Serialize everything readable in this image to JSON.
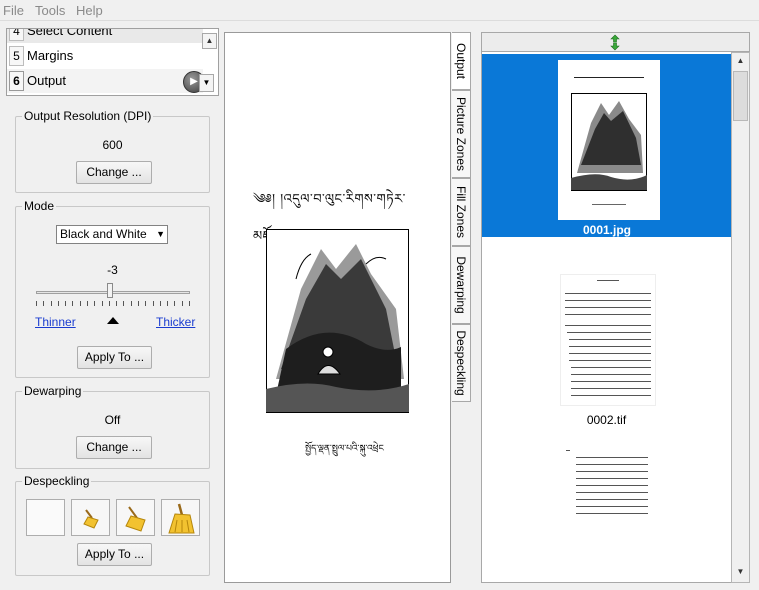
{
  "menu": {
    "items": [
      "File",
      "Tools",
      "Help"
    ]
  },
  "stages": {
    "top_partial": {
      "num": "4",
      "label": "Select Content"
    },
    "items": [
      {
        "num": "5",
        "label": "Margins"
      },
      {
        "num": "6",
        "label": "Output"
      }
    ]
  },
  "output_resolution": {
    "title": "Output Resolution (DPI)",
    "value": "600",
    "change_label": "Change ..."
  },
  "mode": {
    "title": "Mode",
    "selected": "Black and White",
    "threshold": "-3",
    "threshold_fraction": 0.48,
    "thinner_label": "Thinner",
    "thicker_label": "Thicker",
    "apply_label": "Apply To ..."
  },
  "dewarping": {
    "title": "Dewarping",
    "value": "Off",
    "change_label": "Change ..."
  },
  "despeckling": {
    "title": "Despeckling",
    "apply_label": "Apply To ..."
  },
  "preview": {
    "tibetan_title": "༄༅། །འདུལ་བ་ལུང་རིགས་གཏེར་མཛོད།",
    "tibetan_caption": "སྤྱོད་ལྡན་སྤྲུལ་པའི་སྐུ་འཕྲེང"
  },
  "view_tabs": [
    "Output",
    "Picture Zones",
    "Fill Zones",
    "Dewarping",
    "Despeckling"
  ],
  "thumbnails": [
    {
      "label": "0001.jpg",
      "selected": true
    },
    {
      "label": "0002.tif",
      "selected": false
    }
  ],
  "colors": {
    "selection": "#0a78d7",
    "link": "#1a3cd0"
  }
}
